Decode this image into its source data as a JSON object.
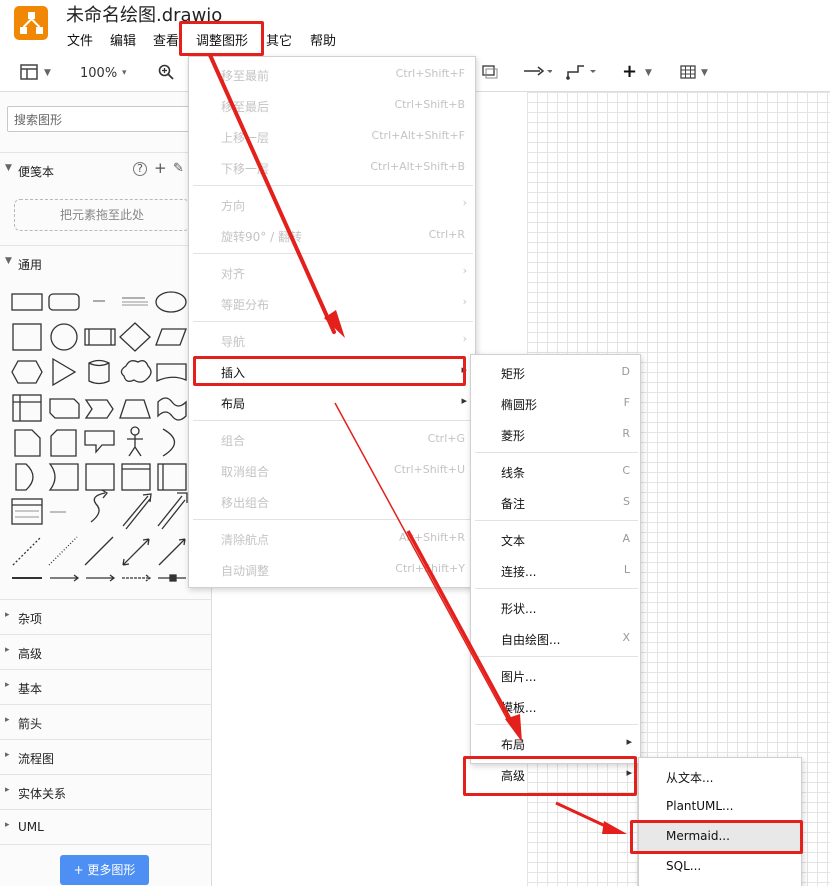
{
  "title": "未命名绘图.drawio",
  "menubar": [
    "文件",
    "编辑",
    "查看",
    "调整图形",
    "其它",
    "帮助"
  ],
  "toolbar": {
    "zoom": "100%",
    "zoom_caret": "▾"
  },
  "sidebar": {
    "search_placeholder": "搜索图形",
    "scratchpad": "便笺本",
    "scratchpad_drop": "把元素拖至此处",
    "general": "通用",
    "sections": [
      "杂项",
      "高级",
      "基本",
      "箭头",
      "流程图",
      "实体关系",
      "UML"
    ],
    "more_shapes": "+ 更多图形"
  },
  "arrange_menu": [
    {
      "label": "移至最前",
      "shortcut": "Ctrl+Shift+F",
      "disabled": true
    },
    {
      "label": "移至最后",
      "shortcut": "Ctrl+Shift+B",
      "disabled": true
    },
    {
      "label": "上移一层",
      "shortcut": "Ctrl+Alt+Shift+F",
      "disabled": true
    },
    {
      "label": "下移一层",
      "shortcut": "Ctrl+Alt+Shift+B",
      "disabled": true
    },
    {
      "label": "方向",
      "arrow": "›",
      "disabled": true
    },
    {
      "label": "旋转90° / 翻转",
      "shortcut": "Ctrl+R",
      "disabled": true
    },
    {
      "label": "对齐",
      "arrow": "›",
      "disabled": true
    },
    {
      "label": "等距分布",
      "arrow": "›",
      "disabled": true
    },
    {
      "label": "导航",
      "arrow": "›",
      "disabled": true
    },
    {
      "label": "插入",
      "arrow": "▸",
      "disabled": false
    },
    {
      "label": "布局",
      "arrow": "▸",
      "disabled": false
    },
    {
      "label": "组合",
      "shortcut": "Ctrl+G",
      "disabled": true
    },
    {
      "label": "取消组合",
      "shortcut": "Ctrl+Shift+U",
      "disabled": true
    },
    {
      "label": "移出组合",
      "shortcut": "",
      "disabled": true
    },
    {
      "label": "清除航点",
      "shortcut": "Alt+Shift+R",
      "disabled": true
    },
    {
      "label": "自动调整",
      "shortcut": "Ctrl+Shift+Y",
      "disabled": true
    }
  ],
  "insert_menu": [
    {
      "label": "矩形",
      "shortcut": "D"
    },
    {
      "label": "椭圆形",
      "shortcut": "F"
    },
    {
      "label": "菱形",
      "shortcut": "R"
    },
    {
      "label": "线条",
      "shortcut": "C"
    },
    {
      "label": "备注",
      "shortcut": "S"
    },
    {
      "label": "文本",
      "shortcut": "A"
    },
    {
      "label": "连接...",
      "shortcut": "L"
    },
    {
      "label": "形状...",
      "shortcut": ""
    },
    {
      "label": "自由绘图...",
      "shortcut": "X"
    },
    {
      "label": "图片...",
      "shortcut": ""
    },
    {
      "label": "模板...",
      "shortcut": ""
    },
    {
      "label": "布局",
      "arrow": "▸"
    },
    {
      "label": "高级",
      "arrow": "▸"
    }
  ],
  "advanced_menu": [
    {
      "label": "从文本..."
    },
    {
      "label": "PlantUML..."
    },
    {
      "label": "Mermaid..."
    },
    {
      "label": "SQL..."
    }
  ],
  "colors": {
    "accent_blue": "#4e8ff3",
    "annotation_red": "#e3201b",
    "logo_orange": "#f08705"
  }
}
